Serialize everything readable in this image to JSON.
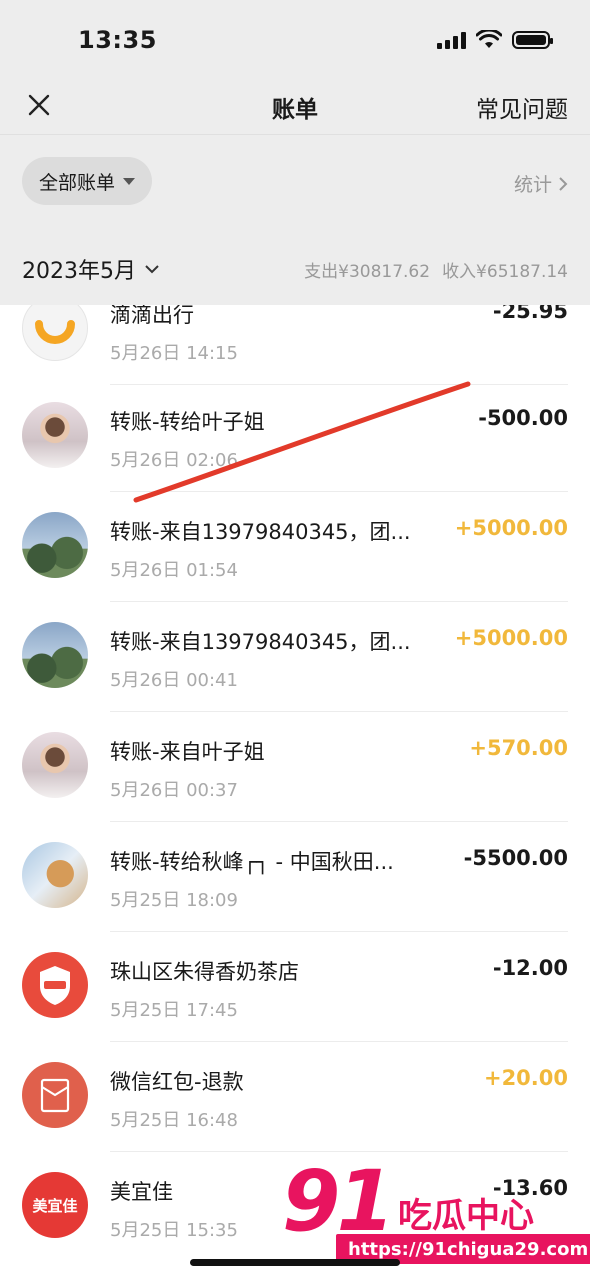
{
  "status_bar": {
    "time": "13:35"
  },
  "nav": {
    "title": "账单",
    "faq_label": "常见问题"
  },
  "filter": {
    "pill_label": "全部账单",
    "stats_label": "统计"
  },
  "month_bar": {
    "month_label": "2023年5月",
    "expense_summary": "支出¥30817.62",
    "income_summary": "收入¥65187.14"
  },
  "transactions": [
    {
      "name": "滴滴出行",
      "date": "5月26日 14:15",
      "amount": "-25.95",
      "avatar": "didi-logo"
    },
    {
      "name": "转账-转给叶子姐",
      "date": "5月26日 02:06",
      "amount": "-500.00",
      "avatar": "person-photo"
    },
    {
      "name": "转账-来自13979840345，团...",
      "date": "5月26日 01:54",
      "amount": "+5000.00",
      "avatar": "tree-photo"
    },
    {
      "name": "转账-来自13979840345，团...",
      "date": "5月26日 00:41",
      "amount": "+5000.00",
      "avatar": "tree-photo"
    },
    {
      "name": "转账-来自叶子姐",
      "date": "5月26日 00:37",
      "amount": "+570.00",
      "avatar": "person-photo"
    },
    {
      "name": "转账-转给秋峰┌┐ - 中国秋田...",
      "date": "5月25日 18:09",
      "amount": "-5500.00",
      "avatar": "dog-photo"
    },
    {
      "name": "珠山区朱得香奶茶店",
      "date": "5月25日 17:45",
      "amount": "-12.00",
      "avatar": "paid-badge"
    },
    {
      "name": "微信红包-退款",
      "date": "5月25日 16:48",
      "amount": "+20.00",
      "avatar": "red-packet-icon"
    },
    {
      "name": "美宜佳",
      "date": "5月25日 15:35",
      "amount": "-13.60",
      "avatar": "meiyijia-logo",
      "logo_text": "美宜佳"
    }
  ],
  "watermark": {
    "number": "91",
    "name": "吃瓜中心",
    "url": "https://91chigua29.com"
  },
  "colors": {
    "income": "#f1b83b",
    "expense": "#1a1a1a",
    "watermark": "#e8145f"
  }
}
